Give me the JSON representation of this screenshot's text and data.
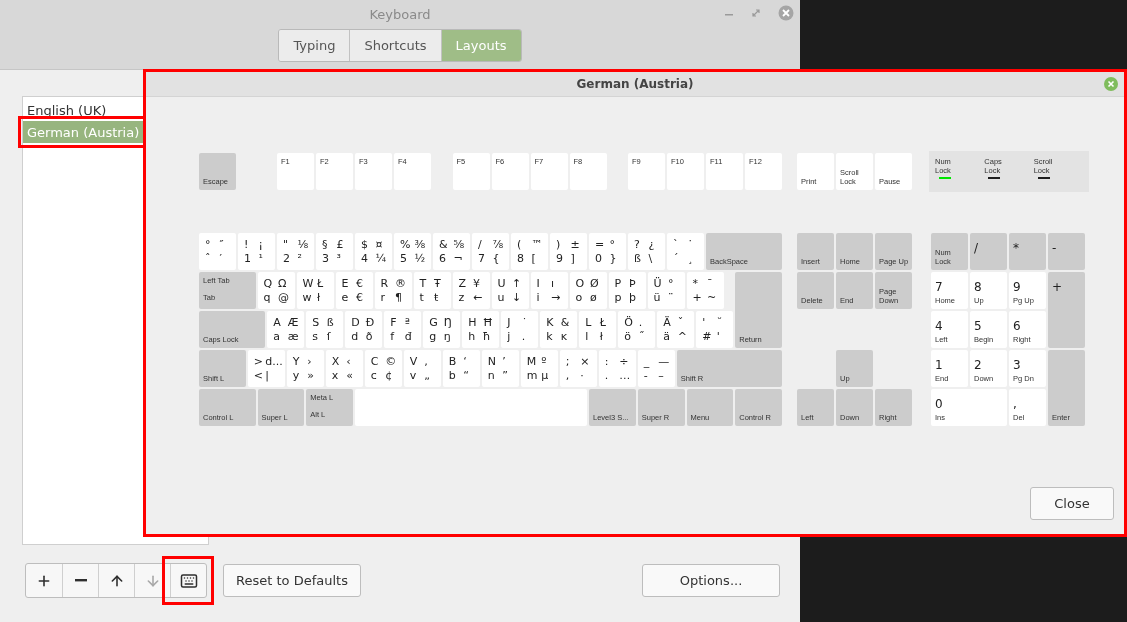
{
  "window": {
    "title": "Keyboard"
  },
  "tabs": [
    {
      "label": "Typing",
      "selected": false
    },
    {
      "label": "Shortcuts",
      "selected": false
    },
    {
      "label": "Layouts",
      "selected": true
    }
  ],
  "layouts": [
    {
      "label": "English (UK)",
      "selected": false,
      "highlighted": false
    },
    {
      "label": "German (Austria)",
      "selected": true,
      "highlighted": true
    }
  ],
  "toolbar": [
    {
      "kind": "add",
      "disabled": false,
      "highlighted": false
    },
    {
      "kind": "remove",
      "disabled": false,
      "highlighted": false
    },
    {
      "kind": "up",
      "disabled": false,
      "highlighted": false
    },
    {
      "kind": "down",
      "disabled": true,
      "highlighted": false
    },
    {
      "kind": "keyboard",
      "disabled": false,
      "highlighted": true
    }
  ],
  "buttons": {
    "reset": "Reset to Defaults",
    "options": "Options..."
  },
  "dialog": {
    "title": "German (Austria)",
    "highlighted": true,
    "close_button": "Close",
    "keyboard": {
      "main": [
        [
          {
            "kind": "modifier",
            "labels": [
              "Escape"
            ]
          },
          {
            "kind": "function",
            "label": "F1"
          },
          {
            "kind": "function",
            "label": "F2"
          },
          {
            "kind": "function",
            "label": "F3"
          },
          {
            "kind": "function",
            "label": "F4"
          },
          {
            "kind": "function",
            "label": "F5"
          },
          {
            "kind": "function",
            "label": "F6"
          },
          {
            "kind": "function",
            "label": "F7"
          },
          {
            "kind": "function",
            "label": "F8"
          },
          {
            "kind": "function",
            "label": "F9"
          },
          {
            "kind": "function",
            "label": "F10"
          },
          {
            "kind": "function",
            "label": "F11"
          },
          {
            "kind": "function",
            "label": "F12"
          }
        ],
        [
          {
            "kind": "char",
            "glyphs": [
              "°",
              "″",
              "ˆ",
              "′"
            ]
          },
          {
            "kind": "char",
            "glyphs": [
              "!",
              "¡",
              "1",
              "¹"
            ]
          },
          {
            "kind": "char",
            "glyphs": [
              "\"",
              "⅛",
              "2",
              "²"
            ]
          },
          {
            "kind": "char",
            "glyphs": [
              "§",
              "£",
              "3",
              "³"
            ]
          },
          {
            "kind": "char",
            "glyphs": [
              "$",
              "¤",
              "4",
              "¼"
            ]
          },
          {
            "kind": "char",
            "glyphs": [
              "%",
              "⅜",
              "5",
              "½"
            ]
          },
          {
            "kind": "char",
            "glyphs": [
              "&",
              "⅝",
              "6",
              "¬"
            ]
          },
          {
            "kind": "char",
            "glyphs": [
              "/",
              "⅞",
              "7",
              "{"
            ]
          },
          {
            "kind": "char",
            "glyphs": [
              "(",
              "™",
              "8",
              "["
            ]
          },
          {
            "kind": "char",
            "glyphs": [
              ")",
              "±",
              "9",
              "]"
            ]
          },
          {
            "kind": "char",
            "glyphs": [
              "=",
              "°",
              "0",
              "}"
            ]
          },
          {
            "kind": "char",
            "glyphs": [
              "?",
              "¿",
              "ß",
              "\\"
            ]
          },
          {
            "kind": "char",
            "glyphs": [
              "`",
              "˙",
              "´",
              "¸"
            ]
          },
          {
            "kind": "modifier",
            "labels": [
              "BackSpace"
            ]
          }
        ],
        [
          {
            "kind": "modifier",
            "labels": [
              "Left Tab",
              "Tab"
            ]
          },
          {
            "kind": "char",
            "glyphs": [
              "Q",
              "Ω",
              "q",
              "@"
            ]
          },
          {
            "kind": "char",
            "glyphs": [
              "W",
              "Ł",
              "w",
              "ł"
            ]
          },
          {
            "kind": "char",
            "glyphs": [
              "E",
              "€",
              "e",
              "€"
            ]
          },
          {
            "kind": "char",
            "glyphs": [
              "R",
              "®",
              "r",
              "¶"
            ]
          },
          {
            "kind": "char",
            "glyphs": [
              "T",
              "Ŧ",
              "t",
              "ŧ"
            ]
          },
          {
            "kind": "char",
            "glyphs": [
              "Z",
              "¥",
              "z",
              "←"
            ]
          },
          {
            "kind": "char",
            "glyphs": [
              "U",
              "↑",
              "u",
              "↓"
            ]
          },
          {
            "kind": "char",
            "glyphs": [
              "I",
              "ı",
              "i",
              "→"
            ]
          },
          {
            "kind": "char",
            "glyphs": [
              "O",
              "Ø",
              "o",
              "ø"
            ]
          },
          {
            "kind": "char",
            "glyphs": [
              "P",
              "Þ",
              "p",
              "þ"
            ]
          },
          {
            "kind": "char",
            "glyphs": [
              "Ü",
              "°",
              "ü",
              "¨"
            ]
          },
          {
            "kind": "char",
            "glyphs": [
              "*",
              "¯",
              "+",
              "~"
            ]
          },
          {
            "kind": "modifier",
            "labels": [
              "Return"
            ]
          }
        ],
        [
          {
            "kind": "modifier",
            "labels": [
              "Caps Lock"
            ]
          },
          {
            "kind": "char",
            "glyphs": [
              "A",
              "Æ",
              "a",
              "æ"
            ]
          },
          {
            "kind": "char",
            "glyphs": [
              "S",
              "ß",
              "s",
              "ſ"
            ]
          },
          {
            "kind": "char",
            "glyphs": [
              "D",
              "Ð",
              "d",
              "ð"
            ]
          },
          {
            "kind": "char",
            "glyphs": [
              "F",
              "ª",
              "f",
              "đ"
            ]
          },
          {
            "kind": "char",
            "glyphs": [
              "G",
              "Ŋ",
              "g",
              "ŋ"
            ]
          },
          {
            "kind": "char",
            "glyphs": [
              "H",
              "Ħ",
              "h",
              "ħ"
            ]
          },
          {
            "kind": "char",
            "glyphs": [
              "J",
              "˙",
              "j",
              "."
            ]
          },
          {
            "kind": "char",
            "glyphs": [
              "K",
              "&",
              "k",
              "ĸ"
            ]
          },
          {
            "kind": "char",
            "glyphs": [
              "L",
              "Ł",
              "l",
              "ł"
            ]
          },
          {
            "kind": "char",
            "glyphs": [
              "Ö",
              ".",
              "ö",
              "˝"
            ]
          },
          {
            "kind": "char",
            "glyphs": [
              "Ä",
              "ˇ",
              "ä",
              "^"
            ]
          },
          {
            "kind": "char",
            "glyphs": [
              "'",
              "˘",
              "#",
              "'"
            ]
          }
        ],
        [
          {
            "kind": "modifier",
            "labels": [
              "Shift L"
            ]
          },
          {
            "kind": "char",
            "glyphs": [
              ">",
              "d...",
              "<",
              "|"
            ]
          },
          {
            "kind": "char",
            "glyphs": [
              "Y",
              "›",
              "y",
              "»"
            ]
          },
          {
            "kind": "char",
            "glyphs": [
              "X",
              "‹",
              "x",
              "«"
            ]
          },
          {
            "kind": "char",
            "glyphs": [
              "C",
              "©",
              "c",
              "¢"
            ]
          },
          {
            "kind": "char",
            "glyphs": [
              "V",
              "‚",
              "v",
              "„"
            ]
          },
          {
            "kind": "char",
            "glyphs": [
              "B",
              "‘",
              "b",
              "“"
            ]
          },
          {
            "kind": "char",
            "glyphs": [
              "N",
              "’",
              "n",
              "”"
            ]
          },
          {
            "kind": "char",
            "glyphs": [
              "M",
              "º",
              "m",
              "µ"
            ]
          },
          {
            "kind": "char",
            "glyphs": [
              ";",
              "×",
              ",",
              "·"
            ]
          },
          {
            "kind": "char",
            "glyphs": [
              ":",
              "÷",
              ".",
              "…"
            ]
          },
          {
            "kind": "char",
            "glyphs": [
              "_",
              "—",
              "-",
              "–"
            ]
          },
          {
            "kind": "modifier",
            "labels": [
              "Shift R"
            ]
          }
        ],
        [
          {
            "kind": "modifier",
            "labels": [
              "Control L"
            ]
          },
          {
            "kind": "modifier",
            "labels": [
              "Super L"
            ]
          },
          {
            "kind": "modifier",
            "labels": [
              "Meta L",
              "Alt L"
            ]
          },
          {
            "kind": "space"
          },
          {
            "kind": "modifier",
            "labels": [
              "Level3 S..."
            ]
          },
          {
            "kind": "modifier",
            "labels": [
              "Super R"
            ]
          },
          {
            "kind": "modifier",
            "labels": [
              "Menu"
            ]
          },
          {
            "kind": "modifier",
            "labels": [
              "Control R"
            ]
          }
        ]
      ],
      "nav": [
        [
          {
            "kind": "system",
            "labels": [
              "Print"
            ]
          },
          {
            "kind": "system",
            "labels": [
              "Scroll Lock"
            ]
          },
          {
            "kind": "system",
            "labels": [
              "Pause"
            ]
          }
        ],
        [
          {
            "kind": "modifier",
            "labels": [
              "Insert"
            ]
          },
          {
            "kind": "modifier",
            "labels": [
              "Home"
            ]
          },
          {
            "kind": "modifier",
            "labels": [
              "Page Up"
            ]
          }
        ],
        [
          {
            "kind": "modifier",
            "labels": [
              "Delete"
            ]
          },
          {
            "kind": "modifier",
            "labels": [
              "End"
            ]
          },
          {
            "kind": "modifier",
            "labels": [
              "Page Down"
            ]
          }
        ],
        [
          {
            "kind": "modifier",
            "labels": [
              "Up"
            ]
          }
        ],
        [
          {
            "kind": "modifier",
            "labels": [
              "Left"
            ]
          },
          {
            "kind": "modifier",
            "labels": [
              "Down"
            ]
          },
          {
            "kind": "modifier",
            "labels": [
              "Right"
            ]
          }
        ]
      ],
      "indicators": [
        {
          "label": "Num Lock",
          "on": true
        },
        {
          "label": "Caps Lock",
          "on": false
        },
        {
          "label": "Scroll Lock",
          "on": false
        }
      ],
      "keypad": [
        [
          {
            "kind": "modifier",
            "labels": [
              "Num Lock"
            ]
          },
          {
            "kind": "keypad-op",
            "label": "/"
          },
          {
            "kind": "keypad-op",
            "label": "*"
          },
          {
            "kind": "keypad-op",
            "label": "-"
          }
        ],
        [
          {
            "kind": "keypad",
            "labels": [
              "7",
              "Home"
            ]
          },
          {
            "kind": "keypad",
            "labels": [
              "8",
              "Up"
            ]
          },
          {
            "kind": "keypad",
            "labels": [
              "9",
              "Pg Up"
            ]
          },
          {
            "kind": "keypad-op",
            "label": "+"
          }
        ],
        [
          {
            "kind": "keypad",
            "labels": [
              "4",
              "Left"
            ]
          },
          {
            "kind": "keypad",
            "labels": [
              "5",
              "Begin"
            ]
          },
          {
            "kind": "keypad",
            "labels": [
              "6",
              "Right"
            ]
          }
        ],
        [
          {
            "kind": "keypad",
            "labels": [
              "1",
              "End"
            ]
          },
          {
            "kind": "keypad",
            "labels": [
              "2",
              "Down"
            ]
          },
          {
            "kind": "keypad",
            "labels": [
              "3",
              "Pg Dn"
            ]
          },
          {
            "kind": "modifier",
            "labels": [
              "Enter"
            ]
          }
        ],
        [
          {
            "kind": "keypad",
            "labels": [
              "0",
              "Ins"
            ]
          },
          {
            "kind": "keypad",
            "labels": [
              ",",
              "Del"
            ]
          }
        ]
      ]
    }
  }
}
